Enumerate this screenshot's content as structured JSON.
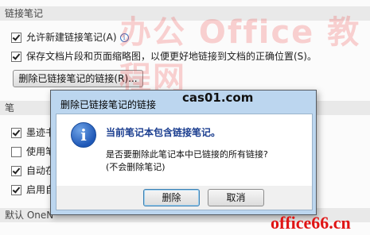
{
  "panel": {
    "section1_header": "链接笔记",
    "option_allow": "允许新建链接笔记(A)",
    "option_save": "保存文档片段和页面缩略图，以便更好地链接到文档的正确位置(S)。",
    "delete_links_button": "删除已链接笔记的链接(R)...",
    "section2_header": "笔",
    "options2": [
      "墨迹书",
      "使用笔",
      "自动在",
      "启用自"
    ],
    "section3_header": "默认 OneN"
  },
  "dialog": {
    "title": "删除已链接笔记的链接",
    "message_bold": "当前笔记本包含链接笔记。",
    "message_question": "是否要删除此笔记本中已链接的所有链接?",
    "message_note": "(不会删除笔记)",
    "delete_button": "删除",
    "cancel_button": "取消"
  },
  "watermarks": {
    "site1": "cas01.com",
    "site2": "office66.cn",
    "bg_text": "办公 Office 教程网"
  },
  "colors": {
    "watermark_red": "#e01414",
    "dialog_frame": "#bcd6ef",
    "button_focus": "#3c7fb1"
  }
}
